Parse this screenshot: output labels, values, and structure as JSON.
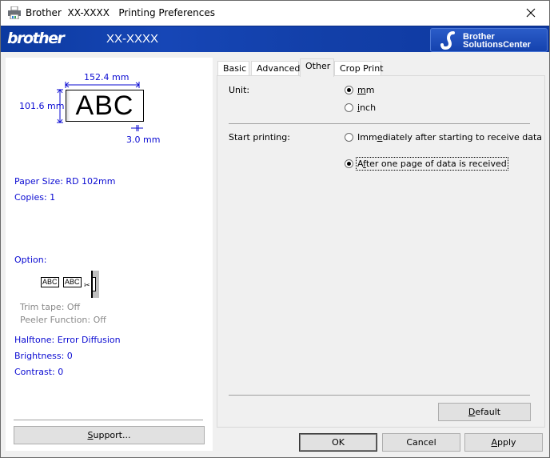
{
  "window": {
    "title": "Brother  XX-XXXX   Printing Preferences",
    "icon": "printer-icon",
    "close_icon": "close-icon"
  },
  "banner": {
    "logo": "brother",
    "model": "XX-XXXX",
    "solutions_center": {
      "line1": "Brother",
      "line2": "SolutionsCenter",
      "icon": "brother-s-icon"
    }
  },
  "preview": {
    "width_label": "152.4 mm",
    "height_label": "101.6 mm",
    "margin_label": "3.0 mm",
    "sample_text": "ABC",
    "paper_size": "Paper Size: RD 102mm",
    "copies": "Copies: 1",
    "option_label": "Option:",
    "option_sample": "ABC",
    "trim_tape": "Trim tape: Off",
    "peeler_function": "Peeler Function: Off",
    "halftone": "Halftone: Error Diffusion",
    "brightness": "Brightness:   0",
    "contrast": "Contrast:   0",
    "support_button": {
      "pre": "",
      "u": "S",
      "post": "upport..."
    }
  },
  "tabs": [
    {
      "label": "Basic",
      "active": false
    },
    {
      "label": "Advanced",
      "active": false
    },
    {
      "label": "Other",
      "active": true
    },
    {
      "label": "Crop Print",
      "active": false
    }
  ],
  "other_tab": {
    "unit": {
      "label": "Unit:",
      "options": [
        {
          "pre": "",
          "u": "m",
          "post": "m",
          "selected": true
        },
        {
          "pre": "",
          "u": "i",
          "post": "nch",
          "selected": false
        }
      ]
    },
    "start_printing": {
      "label": "Start printing:",
      "options": [
        {
          "pre": "Imm",
          "u": "e",
          "post": "diately after starting to receive data",
          "selected": false
        },
        {
          "pre": "A",
          "u": "f",
          "post": "ter one page of data is received",
          "selected": true
        }
      ]
    },
    "default_button": {
      "pre": "",
      "u": "D",
      "post": "efault"
    }
  },
  "footer": {
    "ok": "OK",
    "cancel": "Cancel",
    "apply": {
      "pre": "",
      "u": "A",
      "post": "pply"
    }
  },
  "colors": {
    "banner_blue": "#1442ae",
    "info_text_blue": "#0a0ad2",
    "disabled_grey": "#8a8a8a"
  }
}
